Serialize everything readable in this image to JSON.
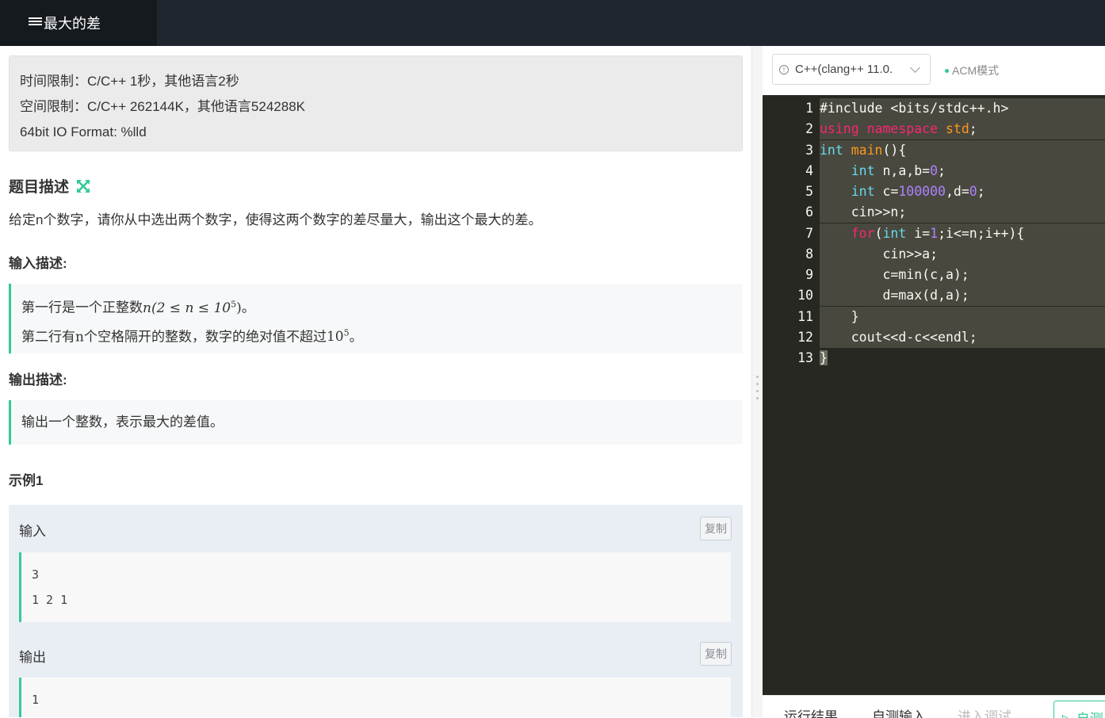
{
  "header": {
    "tab_title": "最大的差"
  },
  "limits": {
    "time": "时间限制：C/C++ 1秒，其他语言2秒",
    "space": "空间限制：C/C++ 262144K，其他语言524288K",
    "io": "64bit IO Format: %lld"
  },
  "problem": {
    "desc_title": "题目描述",
    "desc_text": "给定n个数字，请你从中选出两个数字，使得这两个数字的差尽量大，输出这个最大的差。",
    "input_title": "输入描述:",
    "input_line1_prefix": "第一行是一个正整数",
    "input_line1_math_open": "n(2 ≤ n ≤ 10",
    "input_line1_sup": "5",
    "input_line1_math_close": ")",
    "input_line1_suffix": "。",
    "input_line2_prefix": "第二行有",
    "input_line2_n": "n",
    "input_line2_mid": "个空格隔开的整数，数字的绝对值不超过",
    "input_line2_base": "10",
    "input_line2_sup": "5",
    "input_line2_suffix": "。",
    "output_title": "输出描述:",
    "output_text": "输出一个整数，表示最大的差值。",
    "example_title": "示例1"
  },
  "example": {
    "input_label": "输入",
    "output_label": "输出",
    "copy_label": "复制",
    "input_lines": [
      "3",
      "1 2 1"
    ],
    "output_lines": [
      "1"
    ]
  },
  "editor": {
    "language": "C++(clang++ 11.0.",
    "mode": "ACM模式",
    "lines": [
      "#include <bits/stdc++.h>",
      "using namespace std;",
      "int main(){",
      "    int n,a,b=0;",
      "    int c=100000,d=0;",
      "    cin>>n;",
      "    for(int i=1;i<=n;i++){",
      "        cin>>a;",
      "        c=min(c,a);",
      "        d=max(d,a);",
      "    }",
      "    cout<<d-c<<endl;",
      "}"
    ],
    "line_numbers": [
      "1",
      "2",
      "3",
      "4",
      "5",
      "6",
      "7",
      "8",
      "9",
      "10",
      "11",
      "12",
      "13"
    ]
  },
  "bottom": {
    "tab_result": "运行结果",
    "tab_input": "自测输入",
    "tab_debug": "进入调试",
    "self_test": "自测"
  },
  "colors": {
    "accent": "#32ca99",
    "editor_bg": "#272822",
    "topbar_bg": "#1f262d"
  }
}
